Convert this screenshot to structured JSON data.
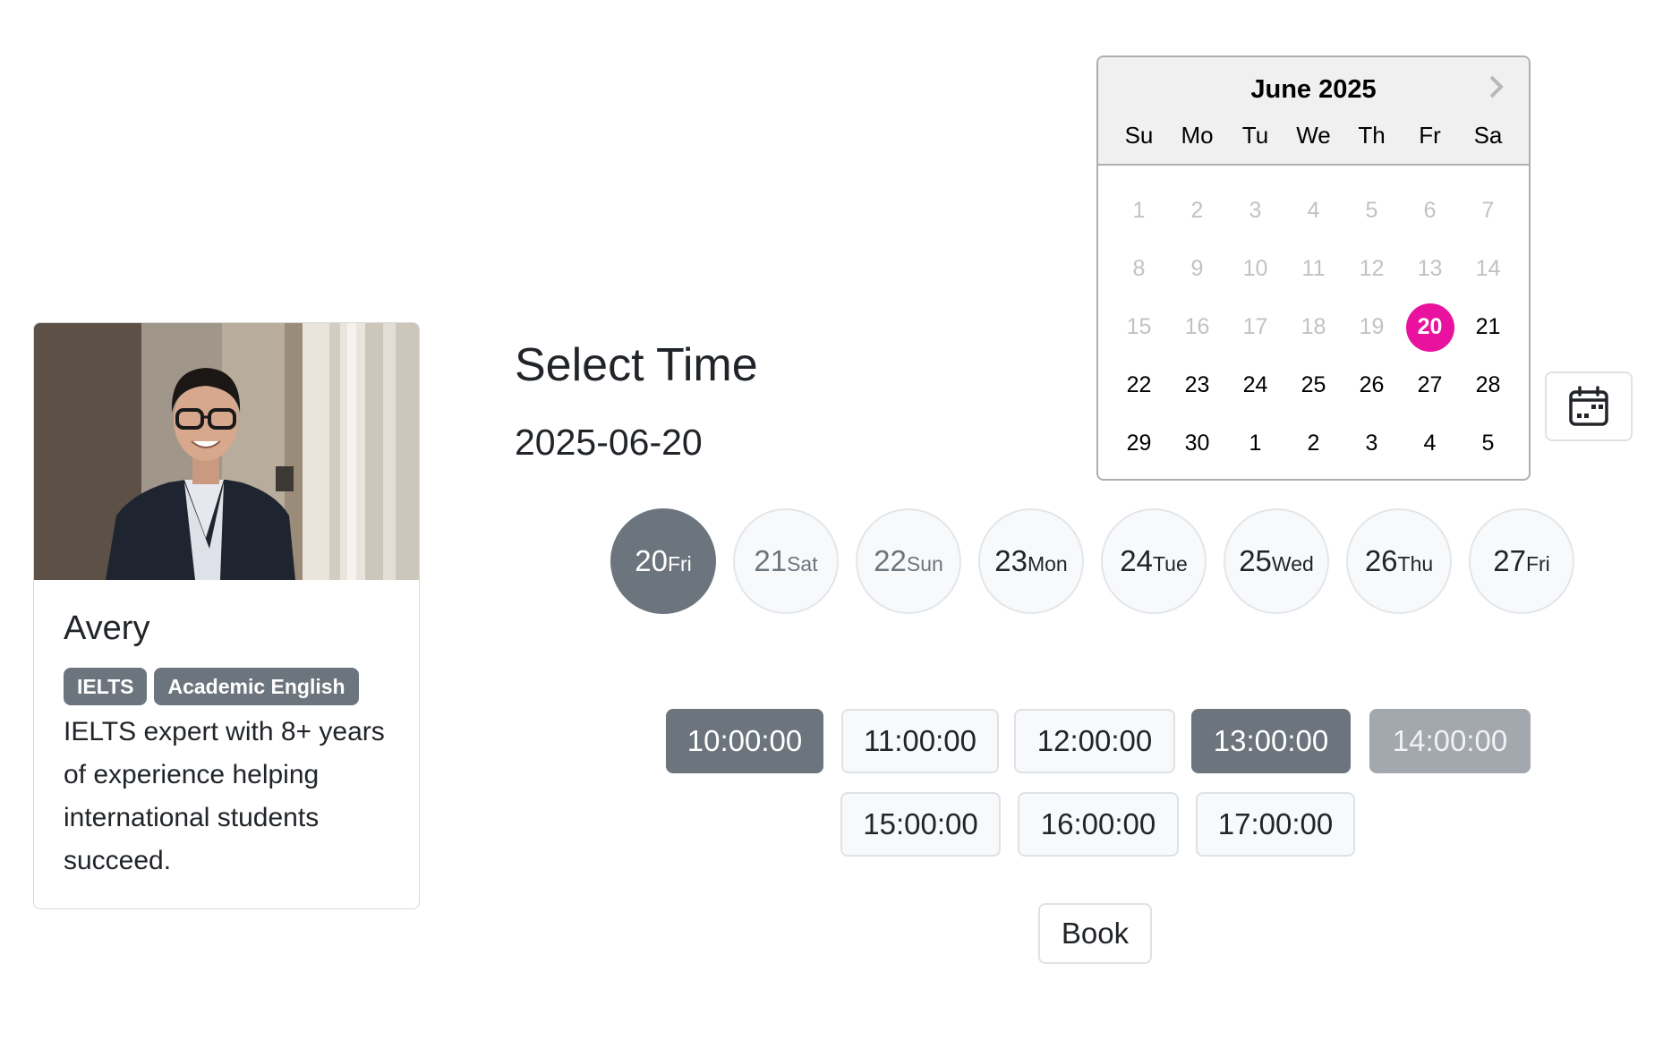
{
  "tutor": {
    "name": "Avery",
    "tags": [
      "IELTS",
      "Academic English"
    ],
    "bio": "IELTS expert with 8+ years of experience helping international students succeed."
  },
  "booking": {
    "title": "Select Time",
    "selected_date": "2025-06-20",
    "book_label": "Book"
  },
  "calendar": {
    "month_label": "June 2025",
    "next_icon": "chevron-right-icon",
    "weekdays": [
      "Su",
      "Mo",
      "Tu",
      "We",
      "Th",
      "Fr",
      "Sa"
    ],
    "days": [
      {
        "d": "1",
        "state": "disabled"
      },
      {
        "d": "2",
        "state": "disabled"
      },
      {
        "d": "3",
        "state": "disabled"
      },
      {
        "d": "4",
        "state": "disabled"
      },
      {
        "d": "5",
        "state": "disabled"
      },
      {
        "d": "6",
        "state": "disabled"
      },
      {
        "d": "7",
        "state": "disabled"
      },
      {
        "d": "8",
        "state": "disabled"
      },
      {
        "d": "9",
        "state": "disabled"
      },
      {
        "d": "10",
        "state": "disabled"
      },
      {
        "d": "11",
        "state": "disabled"
      },
      {
        "d": "12",
        "state": "disabled"
      },
      {
        "d": "13",
        "state": "disabled"
      },
      {
        "d": "14",
        "state": "disabled"
      },
      {
        "d": "15",
        "state": "disabled"
      },
      {
        "d": "16",
        "state": "disabled"
      },
      {
        "d": "17",
        "state": "disabled"
      },
      {
        "d": "18",
        "state": "disabled"
      },
      {
        "d": "19",
        "state": "disabled"
      },
      {
        "d": "20",
        "state": "selected"
      },
      {
        "d": "21",
        "state": "normal"
      },
      {
        "d": "22",
        "state": "normal"
      },
      {
        "d": "23",
        "state": "normal"
      },
      {
        "d": "24",
        "state": "normal"
      },
      {
        "d": "25",
        "state": "normal"
      },
      {
        "d": "26",
        "state": "normal"
      },
      {
        "d": "27",
        "state": "normal"
      },
      {
        "d": "28",
        "state": "normal"
      },
      {
        "d": "29",
        "state": "normal"
      },
      {
        "d": "30",
        "state": "normal"
      },
      {
        "d": "1",
        "state": "normal"
      },
      {
        "d": "2",
        "state": "normal"
      },
      {
        "d": "3",
        "state": "normal"
      },
      {
        "d": "4",
        "state": "normal"
      },
      {
        "d": "5",
        "state": "normal"
      }
    ],
    "selected_color": "#e8129e",
    "toggle_icon": "calendar-icon"
  },
  "day_chips": [
    {
      "num": "20",
      "wd": "Fri",
      "state": "active"
    },
    {
      "num": "21",
      "wd": "Sat",
      "state": "muted"
    },
    {
      "num": "22",
      "wd": "Sun",
      "state": "muted"
    },
    {
      "num": "23",
      "wd": "Mon",
      "state": "normal"
    },
    {
      "num": "24",
      "wd": "Tue",
      "state": "normal"
    },
    {
      "num": "25",
      "wd": "Wed",
      "state": "normal"
    },
    {
      "num": "26",
      "wd": "Thu",
      "state": "normal"
    },
    {
      "num": "27",
      "wd": "Fri",
      "state": "normal"
    }
  ],
  "time_slots": [
    {
      "label": "10:00:00",
      "state": "selected"
    },
    {
      "label": "11:00:00",
      "state": "available"
    },
    {
      "label": "12:00:00",
      "state": "available"
    },
    {
      "label": "13:00:00",
      "state": "booked"
    },
    {
      "label": "14:00:00",
      "state": "disabled"
    },
    {
      "label": "15:00:00",
      "state": "available"
    },
    {
      "label": "16:00:00",
      "state": "available"
    },
    {
      "label": "17:00:00",
      "state": "available"
    }
  ],
  "colors": {
    "accent_grey": "#6c757d",
    "calendar_selected": "#e8129e"
  }
}
